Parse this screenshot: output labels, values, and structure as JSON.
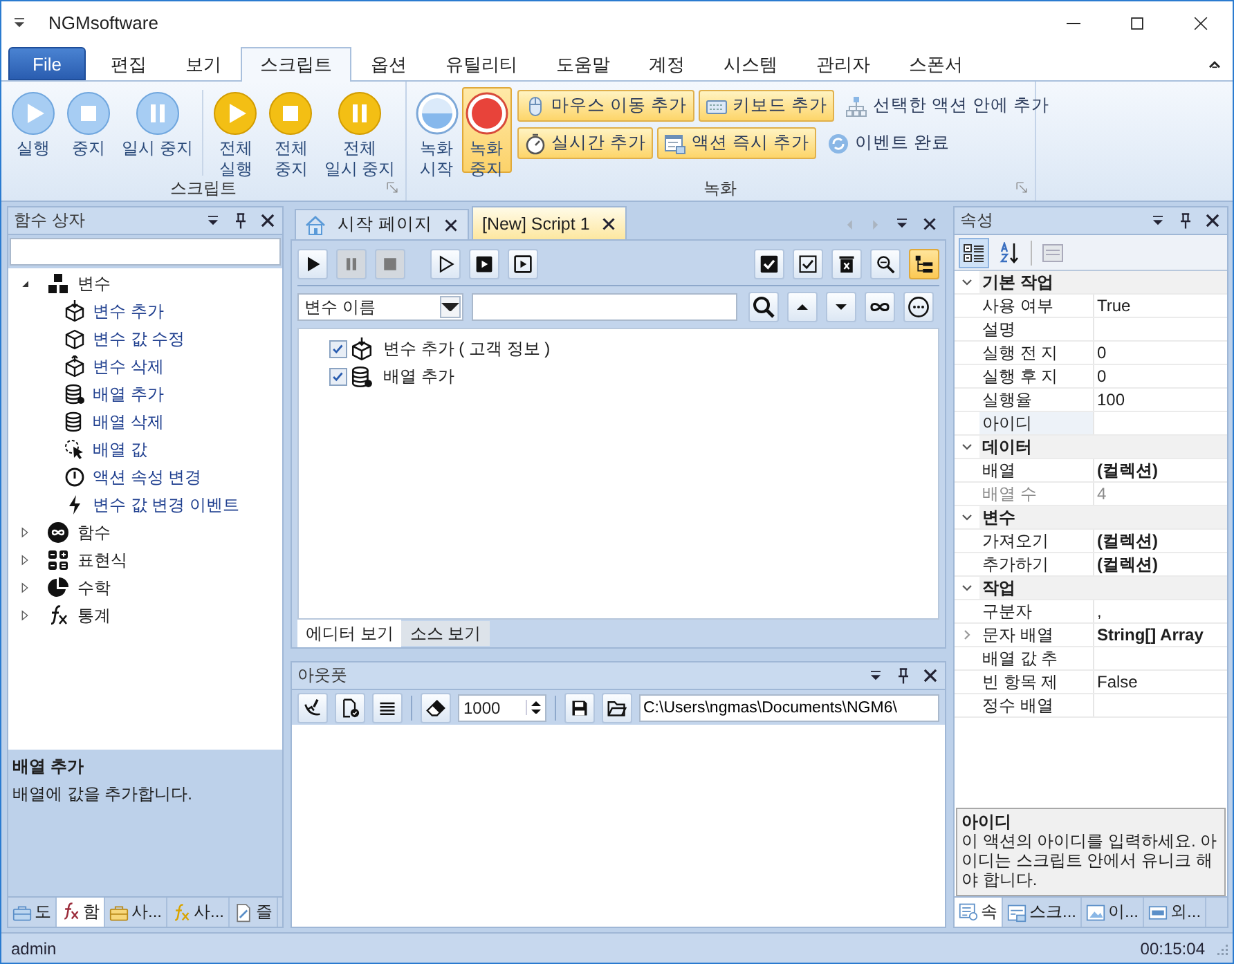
{
  "window": {
    "title": "NGMsoftware"
  },
  "menu_tabs": [
    {
      "label": "File",
      "kind": "file",
      "selected": false
    },
    {
      "label": "편집",
      "kind": "tab",
      "selected": false
    },
    {
      "label": "보기",
      "kind": "tab",
      "selected": false
    },
    {
      "label": "스크립트",
      "kind": "tab",
      "selected": true
    },
    {
      "label": "옵션",
      "kind": "tab",
      "selected": false
    },
    {
      "label": "유틸리티",
      "kind": "tab",
      "selected": false
    },
    {
      "label": "도움말",
      "kind": "tab",
      "selected": false
    },
    {
      "label": "계정",
      "kind": "tab",
      "selected": false
    },
    {
      "label": "시스템",
      "kind": "tab",
      "selected": false
    },
    {
      "label": "관리자",
      "kind": "tab",
      "selected": false
    },
    {
      "label": "스폰서",
      "kind": "tab",
      "selected": false
    }
  ],
  "ribbon": {
    "script_group": {
      "label": "스크립트",
      "sets": [
        [
          {
            "label": "실행",
            "kind": "play"
          },
          {
            "label": "중지",
            "kind": "stop"
          },
          {
            "label": "일시 중지",
            "kind": "pause"
          }
        ],
        [
          {
            "label": "전체\n실행",
            "kind": "play"
          },
          {
            "label": "전체\n중지",
            "kind": "stop"
          },
          {
            "label": "전체\n일시 중지",
            "kind": "pause"
          }
        ]
      ]
    },
    "record_group": {
      "label": "녹화",
      "large": [
        {
          "label": "녹화\n시작",
          "kind": "record-idle",
          "highlighted": false
        },
        {
          "label": "녹화\n중지",
          "kind": "record",
          "highlighted": true
        }
      ],
      "rows": [
        [
          {
            "label": "마우스 이동 추가",
            "kind": "mouse",
            "highlighted": true
          },
          {
            "label": "키보드 추가",
            "kind": "keyboard",
            "highlighted": true
          },
          {
            "label": "선택한 액션 안에 추가",
            "kind": "hierarchy",
            "highlighted": false
          }
        ],
        [
          {
            "label": "실시간 추가",
            "kind": "stopwatch",
            "highlighted": true
          },
          {
            "label": "액션 즉시 추가",
            "kind": "window-add",
            "highlighted": true
          },
          {
            "label": "이벤트 완료",
            "kind": "refresh",
            "highlighted": false
          }
        ]
      ]
    }
  },
  "function_box": {
    "title": "함수 상자",
    "tree": [
      {
        "label": "변수",
        "kind": "blocks",
        "expanded": true,
        "children": [
          {
            "label": "변수 추가",
            "kind": "box-in"
          },
          {
            "label": "변수 값 수정",
            "kind": "box-edit"
          },
          {
            "label": "변수 삭제",
            "kind": "box-out"
          },
          {
            "label": "배열 추가",
            "kind": "db-add"
          },
          {
            "label": "배열 삭제",
            "kind": "db"
          },
          {
            "label": "배열 값",
            "kind": "pointer"
          },
          {
            "label": "액션 속성 변경",
            "kind": "clock"
          },
          {
            "label": "변수 값 변경 이벤트",
            "kind": "bolt"
          }
        ]
      },
      {
        "label": "함수",
        "kind": "infinity-circle",
        "expanded": false
      },
      {
        "label": "표현식",
        "kind": "calc",
        "expanded": false
      },
      {
        "label": "수학",
        "kind": "pie",
        "expanded": false
      },
      {
        "label": "통계",
        "kind": "fx",
        "expanded": false
      }
    ],
    "description": {
      "title": "배열 추가",
      "text": "배열에 값을 추가합니다."
    },
    "tabs": [
      {
        "label": "도",
        "kind": "toolbox",
        "selected": false
      },
      {
        "label": "함",
        "kind": "fx-red",
        "selected": true
      },
      {
        "label": "사...",
        "kind": "toolbox-gold",
        "selected": false
      },
      {
        "label": "사...",
        "kind": "fx-gold",
        "selected": false
      },
      {
        "label": "즐",
        "kind": "page",
        "selected": false
      }
    ]
  },
  "editor": {
    "tabs": [
      {
        "label": "시작 페이지",
        "kind": "home",
        "selected": false
      },
      {
        "label": "[New] Script 1",
        "kind": "plain",
        "selected": true
      }
    ],
    "tools_left": [
      {
        "kind": "play",
        "disabled": false
      },
      {
        "kind": "pause",
        "disabled": true
      },
      {
        "kind": "stop",
        "disabled": true
      },
      {
        "kind": "play-outline",
        "disabled": false
      },
      {
        "kind": "play-square",
        "disabled": false
      },
      {
        "kind": "play-frame",
        "disabled": false
      }
    ],
    "tools_right": [
      {
        "kind": "check-all",
        "selected": false
      },
      {
        "kind": "check-box",
        "selected": false
      },
      {
        "kind": "delete",
        "selected": false
      },
      {
        "kind": "zoom",
        "selected": false
      },
      {
        "kind": "tree",
        "selected": true
      }
    ],
    "filter": {
      "field": "변수 이름"
    },
    "items": [
      {
        "label": "변수 추가 ( 고객 정보 )",
        "kind": "box-in",
        "checked": true
      },
      {
        "label": "배열 추가",
        "kind": "db-add",
        "checked": true
      }
    ],
    "view_tabs": [
      {
        "label": "에디터 보기",
        "selected": true
      },
      {
        "label": "소스 보기",
        "selected": false
      }
    ]
  },
  "output": {
    "title": "아웃풋",
    "count": "1000",
    "path": "C:\\Users\\ngmas\\Documents\\NGM6\\"
  },
  "properties": {
    "title": "속성",
    "categories": [
      {
        "label": "기본 작업",
        "expanded": true,
        "rows": [
          {
            "name": "사용 여부",
            "value": "True",
            "bold": false,
            "selected": false,
            "disabled": false,
            "has_children": false
          },
          {
            "name": "설명",
            "selected": false,
            "disabled": false,
            "has_children": false
          },
          {
            "name": "실행 전 지",
            "value": "0",
            "bold": false,
            "selected": false,
            "disabled": false,
            "has_children": false
          },
          {
            "name": "실행 후 지",
            "value": "0",
            "bold": false,
            "selected": false,
            "disabled": false,
            "has_children": false
          },
          {
            "name": "실행율",
            "value": "100",
            "bold": false,
            "selected": false,
            "disabled": false,
            "has_children": false
          },
          {
            "name": "아이디",
            "selected": true,
            "disabled": false,
            "has_children": false
          }
        ]
      },
      {
        "label": "데이터",
        "expanded": true,
        "rows": [
          {
            "name": "배열",
            "value": "(컬렉션)",
            "bold": true,
            "selected": false,
            "disabled": false,
            "has_children": false
          },
          {
            "name": "배열 수",
            "value": "4",
            "bold": false,
            "selected": false,
            "disabled": true,
            "has_children": false
          }
        ]
      },
      {
        "label": "변수",
        "expanded": true,
        "rows": [
          {
            "name": "가져오기",
            "value": "(컬렉션)",
            "bold": true,
            "selected": false,
            "disabled": false,
            "has_children": false
          },
          {
            "name": "추가하기",
            "value": "(컬렉션)",
            "bold": true,
            "selected": false,
            "disabled": false,
            "has_children": false
          }
        ]
      },
      {
        "label": "작업",
        "expanded": true,
        "rows": [
          {
            "name": "구분자",
            "value": ",",
            "bold": false,
            "selected": false,
            "disabled": false,
            "has_children": false
          },
          {
            "name": "문자 배열",
            "value": "String[] Array",
            "bold": true,
            "selected": false,
            "disabled": false,
            "has_children": true
          },
          {
            "name": "배열 값 추",
            "selected": false,
            "disabled": false,
            "has_children": false
          },
          {
            "name": "빈 항목 제",
            "value": "False",
            "bold": false,
            "selected": false,
            "disabled": false,
            "has_children": false
          },
          {
            "name": "정수 배열",
            "selected": false,
            "disabled": false,
            "has_children": false
          }
        ]
      }
    ],
    "description": {
      "title": "아이디",
      "text": "이 액션의 아이디를 입력하세요. 아이디는 스크립트 안에서 유니크 해야 합니다."
    },
    "tabs": [
      {
        "label": "속",
        "kind": "props",
        "selected": true
      },
      {
        "label": "스크...",
        "kind": "script",
        "selected": false
      },
      {
        "label": "이...",
        "kind": "image",
        "selected": false
      },
      {
        "label": "외...",
        "kind": "api",
        "selected": false
      }
    ]
  },
  "status_bar": {
    "user": "admin",
    "time": "00:15:04"
  }
}
